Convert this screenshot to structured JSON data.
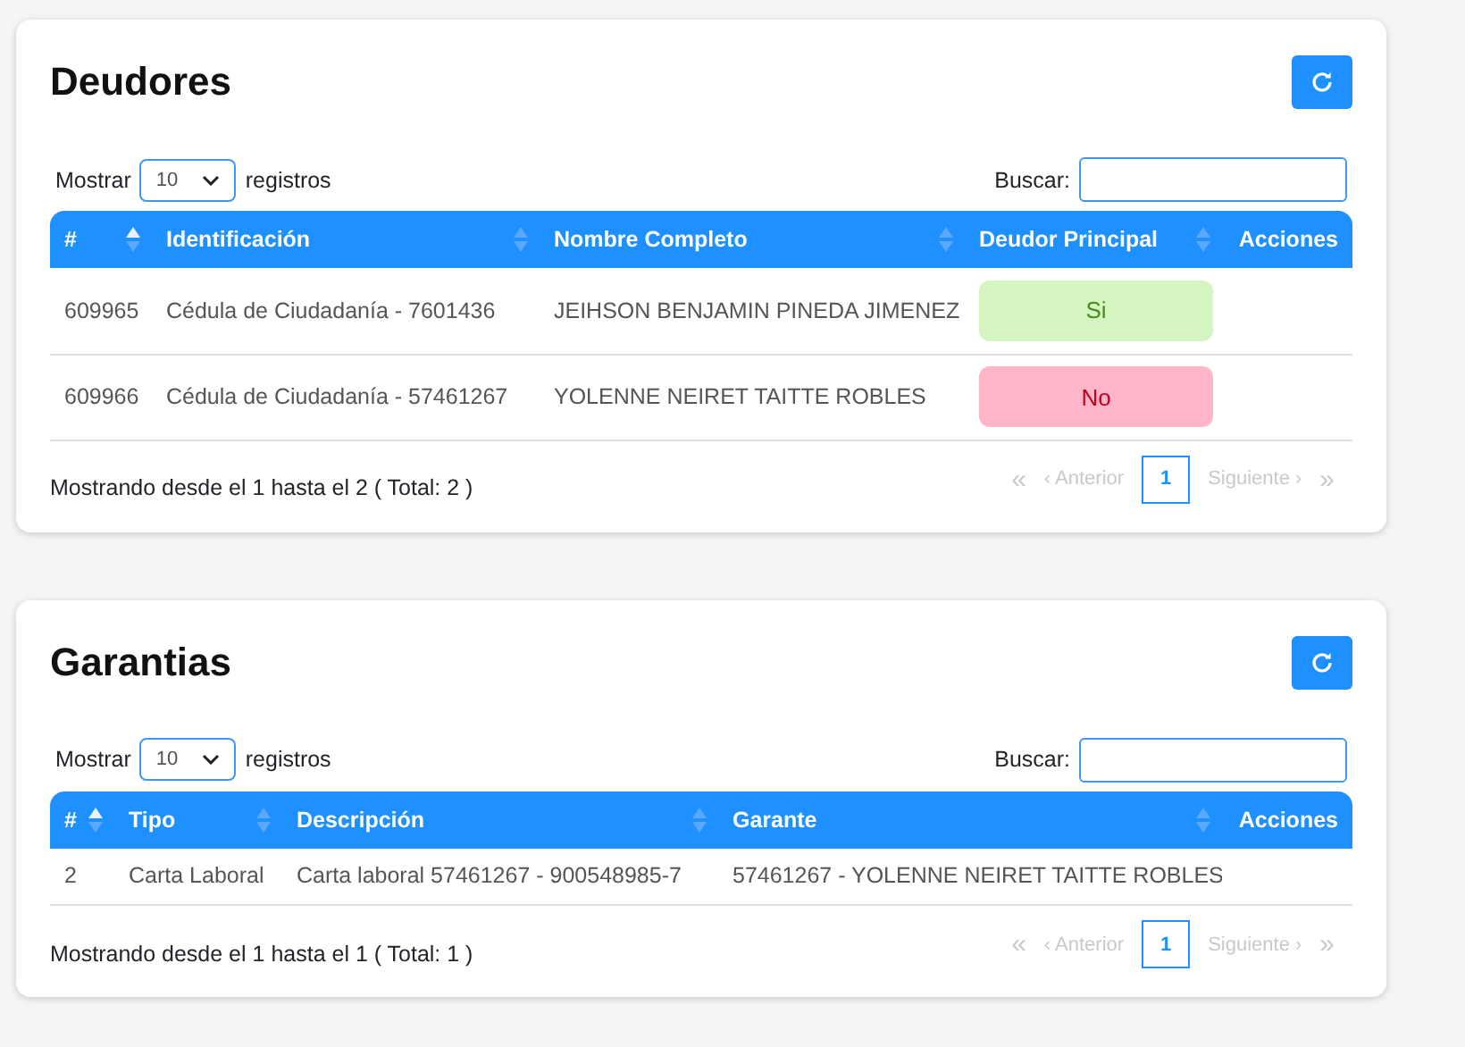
{
  "panels": [
    {
      "title": "Deudores",
      "length_label": "Mostrar",
      "length": "10",
      "length_suffix": "registros",
      "search_label": "Buscar:",
      "columns": [
        {
          "label": "#",
          "sortable": true,
          "sorted": true
        },
        {
          "label": "Identificación",
          "sortable": true,
          "sorted": false
        },
        {
          "label": "Nombre Completo",
          "sortable": true,
          "sorted": false
        },
        {
          "label": "Deudor Principal",
          "sortable": true,
          "sorted": false
        },
        {
          "label": "Acciones",
          "sortable": false
        }
      ],
      "rows": [
        {
          "cells": [
            {
              "kind": "text",
              "text": "609965"
            },
            {
              "kind": "text",
              "text": "Cédula de Ciudadanía - 7601436"
            },
            {
              "kind": "text",
              "text": "JEIHSON BENJAMIN PINEDA JIMENEZ"
            },
            {
              "kind": "badge",
              "text": "Si",
              "positive": true
            }
          ]
        },
        {
          "cells": [
            {
              "kind": "text",
              "text": "609966"
            },
            {
              "kind": "text",
              "text": "Cédula de Ciudadanía - 57461267"
            },
            {
              "kind": "text",
              "text": "YOLENNE NEIRET TAITTE ROBLES"
            },
            {
              "kind": "badge",
              "text": "No",
              "positive": false
            }
          ]
        }
      ],
      "info": "Mostrando desde el 1 hasta el 2 ( Total: 2 )",
      "pager": {
        "first": "«",
        "prev": "‹ Anterior",
        "pages": [
          {
            "label": "1",
            "selected": true
          }
        ],
        "next": "Siguiente ›",
        "last": "»"
      }
    },
    {
      "title": "Garantias",
      "length_label": "Mostrar",
      "length": "10",
      "length_suffix": "registros",
      "search_label": "Buscar:",
      "columns": [
        {
          "label": "#",
          "sortable": true,
          "sorted": true
        },
        {
          "label": "Tipo",
          "sortable": true,
          "sorted": false
        },
        {
          "label": "Descripción",
          "sortable": true,
          "sorted": false
        },
        {
          "label": "Garante",
          "sortable": true,
          "sorted": false
        },
        {
          "label": "Acciones",
          "sortable": false
        }
      ],
      "rows": [
        {
          "cells": [
            {
              "kind": "text",
              "text": "2"
            },
            {
              "kind": "text",
              "text": "Carta Laboral"
            },
            {
              "kind": "text",
              "text": "Carta laboral 57461267 - 900548985-7"
            },
            {
              "kind": "text",
              "text": "57461267 - YOLENNE NEIRET TAITTE ROBLES"
            }
          ]
        }
      ],
      "info": "Mostrando desde el 1 hasta el 1 ( Total: 1 )",
      "pager": {
        "first": "«",
        "prev": "‹ Anterior",
        "pages": [
          {
            "label": "1",
            "selected": true
          }
        ],
        "next": "Siguiente ›",
        "last": "»"
      }
    }
  ]
}
